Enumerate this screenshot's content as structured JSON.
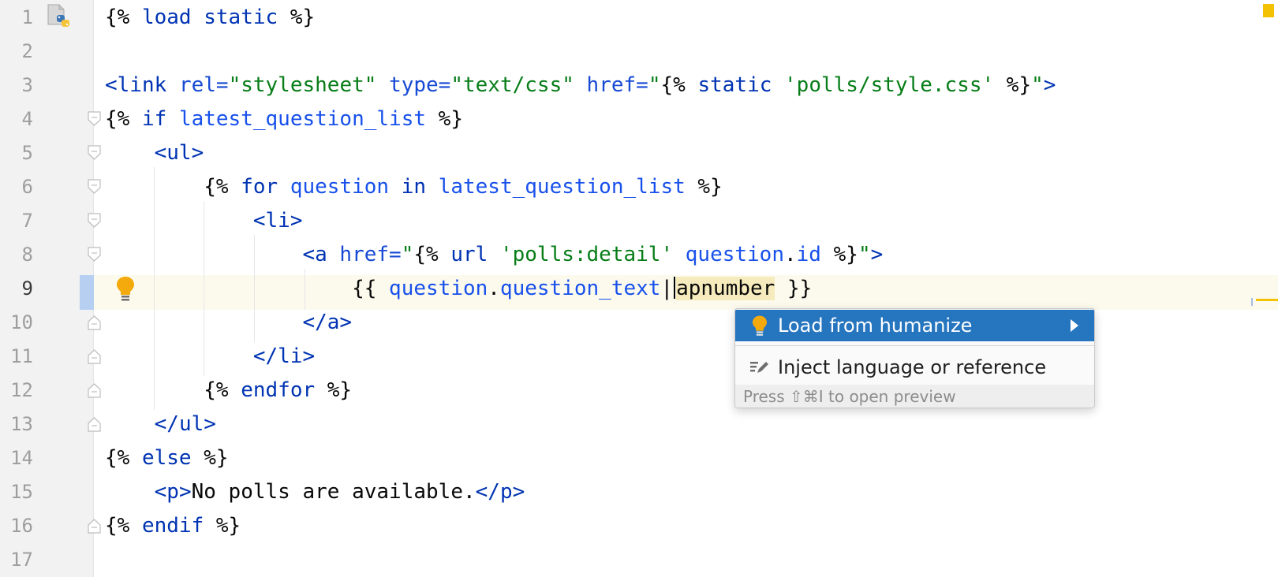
{
  "editor": {
    "file_type_icon": "python-django-template-file-icon",
    "current_line": 9,
    "line_numbers": [
      "1",
      "2",
      "3",
      "4",
      "5",
      "6",
      "7",
      "8",
      "9",
      "10",
      "11",
      "12",
      "13",
      "14",
      "15",
      "16",
      "17"
    ],
    "lines": [
      [
        [
          "delim",
          "{%"
        ],
        [
          "txt",
          " "
        ],
        [
          "kw",
          "load"
        ],
        [
          "txt",
          " "
        ],
        [
          "kw",
          "static"
        ],
        [
          "txt",
          " "
        ],
        [
          "delim",
          "%}"
        ]
      ],
      [],
      [
        [
          "tag",
          "<"
        ],
        [
          "tag",
          "link"
        ],
        [
          "txt",
          " "
        ],
        [
          "attr",
          "rel="
        ],
        [
          "str",
          "\"stylesheet\""
        ],
        [
          "txt",
          " "
        ],
        [
          "attr",
          "type="
        ],
        [
          "str",
          "\"text/css\""
        ],
        [
          "txt",
          " "
        ],
        [
          "attr",
          "href="
        ],
        [
          "str",
          "\""
        ],
        [
          "delim",
          "{%"
        ],
        [
          "txt",
          " "
        ],
        [
          "kw",
          "static"
        ],
        [
          "txt",
          " "
        ],
        [
          "str",
          "'polls/style.css'"
        ],
        [
          "txt",
          " "
        ],
        [
          "delim",
          "%}"
        ],
        [
          "str",
          "\""
        ],
        [
          "tag",
          ">"
        ]
      ],
      [
        [
          "delim",
          "{%"
        ],
        [
          "txt",
          " "
        ],
        [
          "kw",
          "if"
        ],
        [
          "txt",
          " "
        ],
        [
          "var",
          "latest_question_list"
        ],
        [
          "txt",
          " "
        ],
        [
          "delim",
          "%}"
        ]
      ],
      [
        [
          "txt",
          "    "
        ],
        [
          "tag",
          "<"
        ],
        [
          "tag",
          "ul"
        ],
        [
          "tag",
          ">"
        ]
      ],
      [
        [
          "txt",
          "        "
        ],
        [
          "delim",
          "{%"
        ],
        [
          "txt",
          " "
        ],
        [
          "kw",
          "for"
        ],
        [
          "txt",
          " "
        ],
        [
          "var",
          "question"
        ],
        [
          "txt",
          " "
        ],
        [
          "kw",
          "in"
        ],
        [
          "txt",
          " "
        ],
        [
          "var",
          "latest_question_list"
        ],
        [
          "txt",
          " "
        ],
        [
          "delim",
          "%}"
        ]
      ],
      [
        [
          "txt",
          "            "
        ],
        [
          "tag",
          "<"
        ],
        [
          "tag",
          "li"
        ],
        [
          "tag",
          ">"
        ]
      ],
      [
        [
          "txt",
          "                "
        ],
        [
          "tag",
          "<"
        ],
        [
          "tag",
          "a"
        ],
        [
          "txt",
          " "
        ],
        [
          "attr",
          "href="
        ],
        [
          "str",
          "\""
        ],
        [
          "delim",
          "{%"
        ],
        [
          "txt",
          " "
        ],
        [
          "kw",
          "url"
        ],
        [
          "txt",
          " "
        ],
        [
          "str",
          "'polls:detail'"
        ],
        [
          "txt",
          " "
        ],
        [
          "var",
          "question"
        ],
        [
          "dot",
          "."
        ],
        [
          "var",
          "id"
        ],
        [
          "txt",
          " "
        ],
        [
          "delim",
          "%}"
        ],
        [
          "str",
          "\""
        ],
        [
          "tag",
          ">"
        ]
      ],
      [
        [
          "txt",
          "                    "
        ],
        [
          "delim",
          "{{"
        ],
        [
          "txt",
          " "
        ],
        [
          "var",
          "question"
        ],
        [
          "dot",
          "."
        ],
        [
          "var",
          "question_text"
        ],
        [
          "dot",
          "|"
        ],
        [
          "caret",
          ""
        ],
        [
          "err",
          "apnumber"
        ],
        [
          "txt",
          " "
        ],
        [
          "delim",
          "}}"
        ]
      ],
      [
        [
          "txt",
          "                "
        ],
        [
          "tag",
          "</"
        ],
        [
          "tag",
          "a"
        ],
        [
          "tag",
          ">"
        ]
      ],
      [
        [
          "txt",
          "            "
        ],
        [
          "tag",
          "</"
        ],
        [
          "tag",
          "li"
        ],
        [
          "tag",
          ">"
        ]
      ],
      [
        [
          "txt",
          "        "
        ],
        [
          "delim",
          "{%"
        ],
        [
          "txt",
          " "
        ],
        [
          "kw",
          "endfor"
        ],
        [
          "txt",
          " "
        ],
        [
          "delim",
          "%}"
        ]
      ],
      [
        [
          "txt",
          "    "
        ],
        [
          "tag",
          "</"
        ],
        [
          "tag",
          "ul"
        ],
        [
          "tag",
          ">"
        ]
      ],
      [
        [
          "delim",
          "{%"
        ],
        [
          "txt",
          " "
        ],
        [
          "kw",
          "else"
        ],
        [
          "txt",
          " "
        ],
        [
          "delim",
          "%}"
        ]
      ],
      [
        [
          "txt",
          "    "
        ],
        [
          "tag",
          "<"
        ],
        [
          "tag",
          "p"
        ],
        [
          "tag",
          ">"
        ],
        [
          "txt",
          "No polls are available."
        ],
        [
          "tag",
          "</"
        ],
        [
          "tag",
          "p"
        ],
        [
          "tag",
          ">"
        ]
      ],
      [
        [
          "delim",
          "{%"
        ],
        [
          "txt",
          " "
        ],
        [
          "kw",
          "endif"
        ],
        [
          "txt",
          " "
        ],
        [
          "delim",
          "%}"
        ]
      ],
      []
    ]
  },
  "intention_popup": {
    "items": [
      {
        "label": "Load from humanize",
        "icon": "lightbulb-icon",
        "has_submenu": true,
        "selected": true
      },
      {
        "label": "Inject language or reference",
        "icon": "inject-language-icon",
        "has_submenu": false,
        "selected": false
      }
    ],
    "footer": "Press ⇧⌘I to open preview"
  },
  "colors": {
    "keyword": "#0033b3",
    "string": "#067d17",
    "selection": "#2675bf",
    "warning": "#f2c203"
  }
}
